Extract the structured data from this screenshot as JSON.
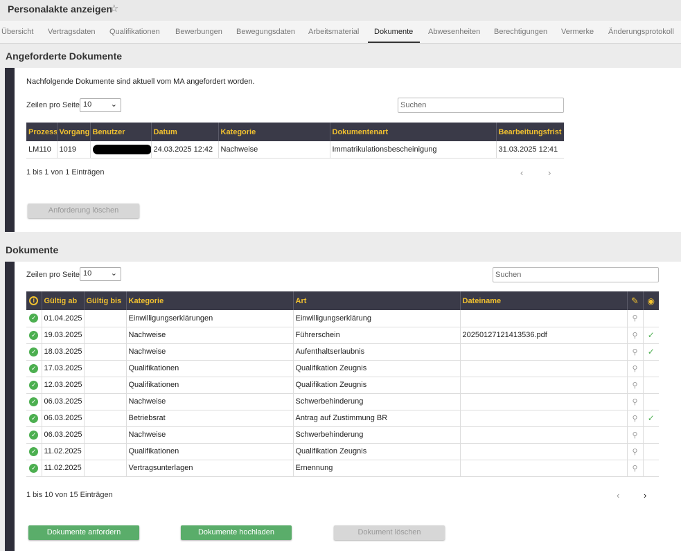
{
  "header": {
    "title": "Personalakte anzeigen",
    "star": "☆"
  },
  "tabs": [
    {
      "label": "Übersicht"
    },
    {
      "label": "Vertragsdaten"
    },
    {
      "label": "Qualifikationen"
    },
    {
      "label": "Bewerbungen"
    },
    {
      "label": "Bewegungsdaten"
    },
    {
      "label": "Arbeitsmaterial"
    },
    {
      "label": "Dokumente",
      "active": true
    },
    {
      "label": "Abwesenheiten"
    },
    {
      "label": "Berechtigungen"
    },
    {
      "label": "Vermerke"
    },
    {
      "label": "Änderungsprotokoll"
    }
  ],
  "requested": {
    "title": "Angeforderte Dokumente",
    "hint": "Nachfolgende Dokumente sind aktuell vom MA angefordert worden.",
    "rows_label": "Zeilen pro Seite",
    "rows_value": "10",
    "search_placeholder": "Suchen",
    "columns": [
      "Prozess",
      "Vorgang",
      "Benutzer",
      "Datum",
      "Kategorie",
      "Dokumentenart",
      "Bearbeitungsfrist"
    ],
    "rows": [
      {
        "prozess": "LM110",
        "vorgang": "1019",
        "datum": "24.03.2025 12:42",
        "kategorie": "Nachweise",
        "art": "Immatrikulationsbescheinigung",
        "frist": "31.03.2025 12:41"
      }
    ],
    "pager_info": "1 bis 1 von 1 Einträgen",
    "prev": "‹",
    "next": "›",
    "delete_button": "Anforderung löschen"
  },
  "documents": {
    "title": "Dokumente",
    "rows_label": "Zeilen pro Seite",
    "rows_value": "10",
    "search_placeholder": "Suchen",
    "columns": [
      "Gültig ab",
      "Gültig bis",
      "Kategorie",
      "Art",
      "Dateiname"
    ],
    "rows": [
      {
        "ab": "01.04.2025",
        "bis": "",
        "kategorie": "Einwilligungserklärungen",
        "art": "Einwilligungserklärung",
        "datei": "",
        "seen": false
      },
      {
        "ab": "19.03.2025",
        "bis": "",
        "kategorie": "Nachweise",
        "art": "Führerschein",
        "datei": "20250127121413536.pdf",
        "seen": true
      },
      {
        "ab": "18.03.2025",
        "bis": "",
        "kategorie": "Nachweise",
        "art": "Aufenthaltserlaubnis",
        "datei": "",
        "seen": true
      },
      {
        "ab": "17.03.2025",
        "bis": "",
        "kategorie": "Qualifikationen",
        "art": "Qualifikation Zeugnis",
        "datei": "",
        "seen": false
      },
      {
        "ab": "12.03.2025",
        "bis": "",
        "kategorie": "Qualifikationen",
        "art": "Qualifikation Zeugnis",
        "datei": "",
        "seen": false
      },
      {
        "ab": "06.03.2025",
        "bis": "",
        "kategorie": "Nachweise",
        "art": "Schwerbehinderung",
        "datei": "",
        "seen": false
      },
      {
        "ab": "06.03.2025",
        "bis": "",
        "kategorie": "Betriebsrat",
        "art": "Antrag auf Zustimmung BR",
        "datei": "",
        "seen": true
      },
      {
        "ab": "06.03.2025",
        "bis": "",
        "kategorie": "Nachweise",
        "art": "Schwerbehinderung",
        "datei": "",
        "seen": false
      },
      {
        "ab": "11.02.2025",
        "bis": "",
        "kategorie": "Qualifikationen",
        "art": "Qualifikation Zeugnis",
        "datei": "",
        "seen": false
      },
      {
        "ab": "11.02.2025",
        "bis": "",
        "kategorie": "Vertragsunterlagen",
        "art": "Ernennung",
        "datei": "",
        "seen": false
      }
    ],
    "pager_info": "1 bis 10 von 15 Einträgen",
    "prev": "‹",
    "next": "›",
    "buttons": {
      "request": "Dokumente anfordern",
      "upload": "Dokumente hochladen",
      "delete": "Dokument löschen"
    }
  },
  "icons": {
    "ok": "✓",
    "search": "⚲",
    "check": "✓",
    "info": "i",
    "edit": "✎",
    "eye": "◉"
  },
  "colors": {
    "accent": "#f0c030",
    "header_bg": "#3a3a48",
    "success": "#4caf50",
    "button_green": "#5aad6a"
  }
}
